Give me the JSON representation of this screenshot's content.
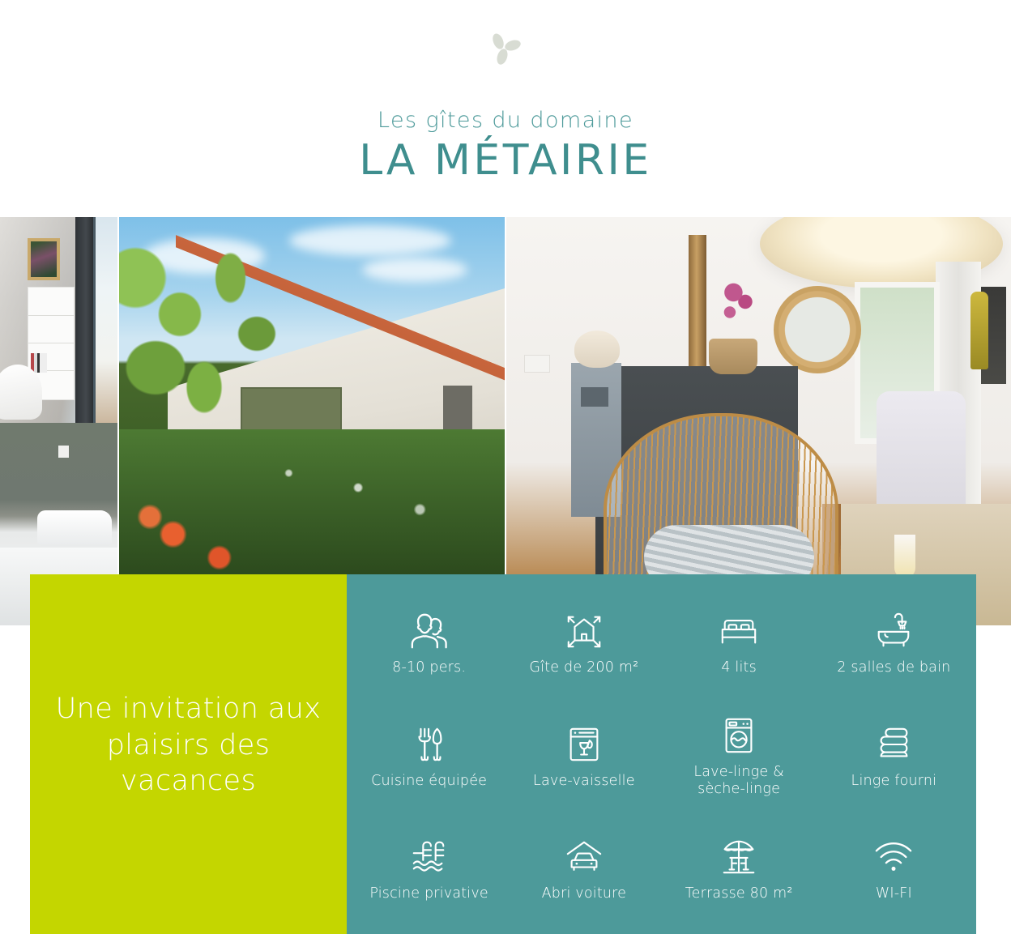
{
  "header": {
    "logo_icon": "leaf-flower-logo",
    "pretitle": "Les gîtes du domaine",
    "title": "LA MÉTAIRIE"
  },
  "colors": {
    "teal": "#4d9a9a",
    "title_teal": "#3f8e8e",
    "green": "#c4d600",
    "white": "#ffffff",
    "logo_grey": "#d8dcd3"
  },
  "gallery": {
    "photos": [
      {
        "name": "photo-living-room",
        "alt": "Salon avec tableau et étagère blanche"
      },
      {
        "name": "photo-bedroom",
        "alt": "Chambre avec lit fait"
      },
      {
        "name": "photo-house-exterior",
        "alt": "Extérieur de la maison, jardin et piscine"
      },
      {
        "name": "photo-interior-lounge",
        "alt": "Salon intérieur avec fauteuil en rotin et poêle"
      }
    ]
  },
  "tagline": {
    "text": "Une invitation aux plaisirs des vacances"
  },
  "features": [
    {
      "icon": "people-icon",
      "label": "8-10 pers."
    },
    {
      "icon": "house-resize-icon",
      "label": "Gîte de 200 m²"
    },
    {
      "icon": "bed-icon",
      "label": "4 lits"
    },
    {
      "icon": "bathtub-icon",
      "label": "2 salles de bain"
    },
    {
      "icon": "cutlery-icon",
      "label": "Cuisine équipée"
    },
    {
      "icon": "dishwasher-icon",
      "label": "Lave-vaisselle"
    },
    {
      "icon": "washing-machine-icon",
      "label": "Lave-linge &\nsèche-linge"
    },
    {
      "icon": "folded-linen-icon",
      "label": "Linge fourni"
    },
    {
      "icon": "pool-icon",
      "label": "Piscine privative"
    },
    {
      "icon": "carport-icon",
      "label": "Abri voiture"
    },
    {
      "icon": "parasol-table-icon",
      "label": "Terrasse 80 m²"
    },
    {
      "icon": "wifi-icon",
      "label": "WI-FI"
    }
  ]
}
